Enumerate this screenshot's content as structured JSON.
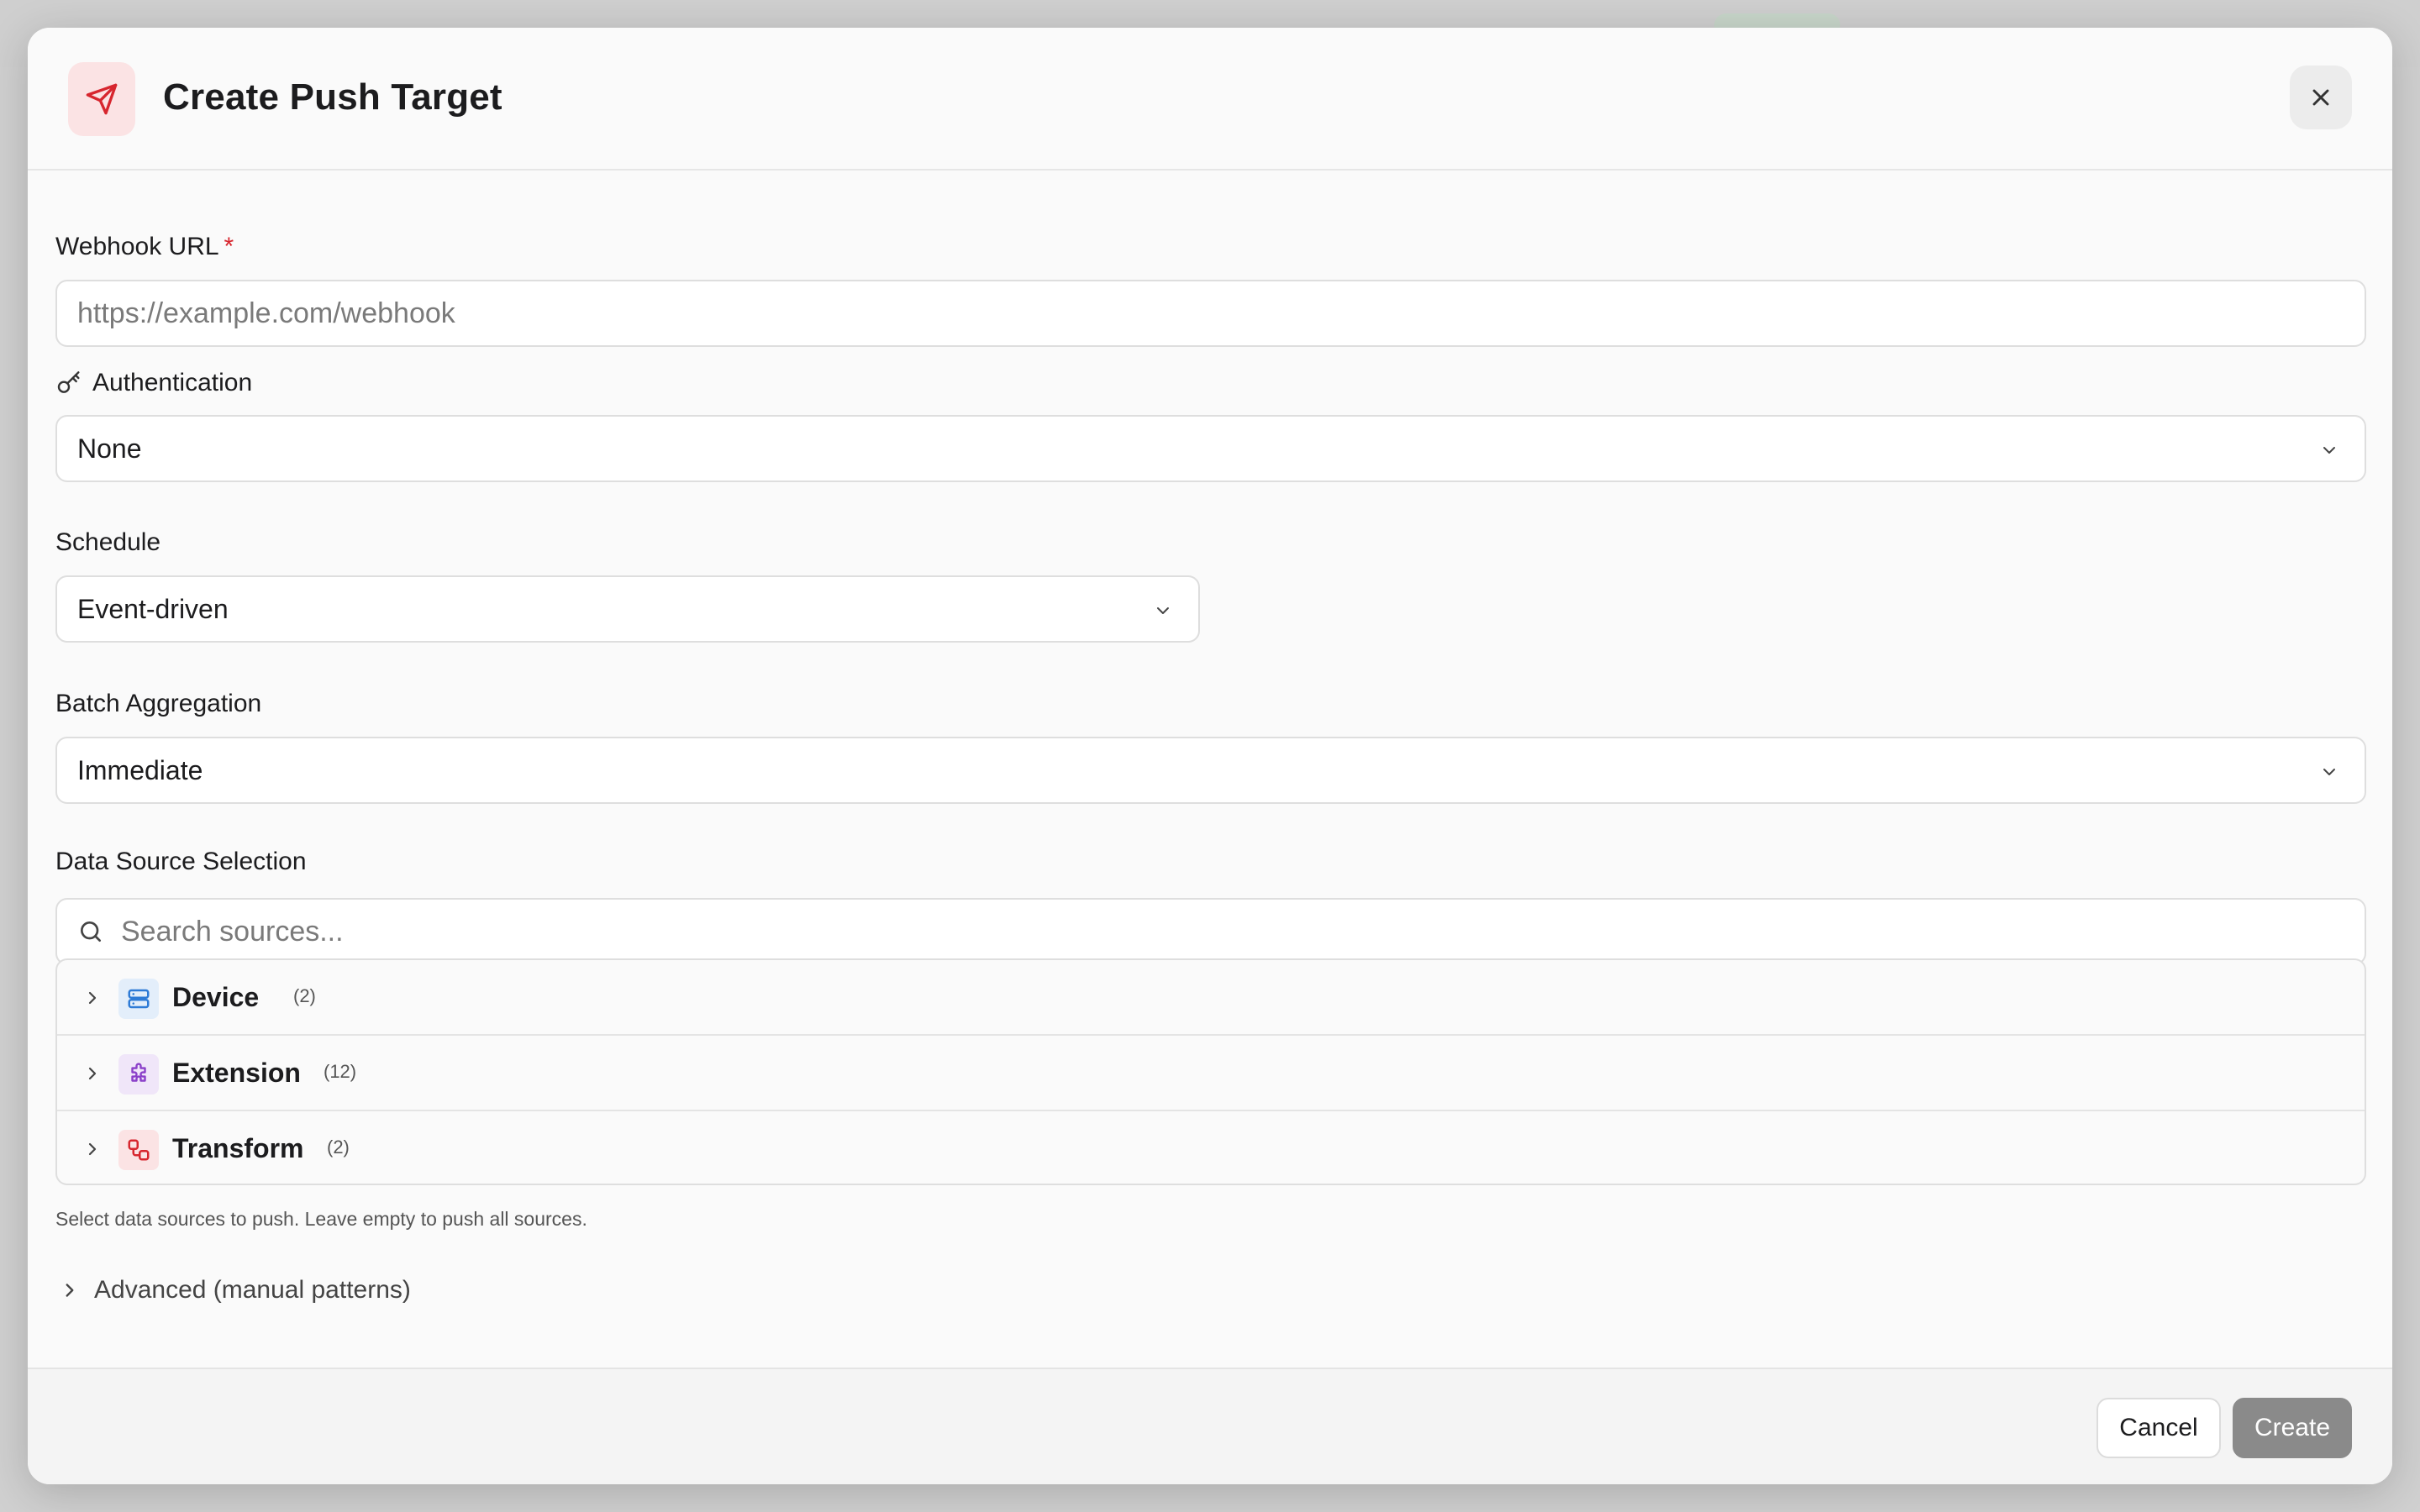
{
  "dialog": {
    "title": "Create Push Target",
    "close_label": "close"
  },
  "webhook": {
    "label": "Webhook URL",
    "required_mark": "*",
    "placeholder": "https://example.com/webhook",
    "value": ""
  },
  "authentication": {
    "label": "Authentication",
    "selected": "None"
  },
  "schedule": {
    "label": "Schedule",
    "selected": "Event-driven"
  },
  "batch": {
    "label": "Batch Aggregation",
    "selected": "Immediate"
  },
  "sources": {
    "label": "Data Source Selection",
    "search_placeholder": "Search sources...",
    "groups": [
      {
        "label": "Device",
        "count": "(2)",
        "icon": "server-icon",
        "icon_color": "#2e7bd6",
        "icon_bg": "#e3eefa"
      },
      {
        "label": "Extension",
        "count": "(12)",
        "icon": "puzzle-icon",
        "icon_color": "#8a3fc9",
        "icon_bg": "#f0e6f9"
      },
      {
        "label": "Transform",
        "count": "(2)",
        "icon": "workflow-icon",
        "icon_color": "#d7262e",
        "icon_bg": "#fbe3e4"
      }
    ],
    "helper": "Select data sources to push. Leave empty to push all sources."
  },
  "advanced": {
    "label": "Advanced (manual patterns)"
  },
  "footer": {
    "cancel_label": "Cancel",
    "create_label": "Create"
  },
  "colors": {
    "accent": "#d7262e",
    "create_disabled": "#8a8a8a"
  }
}
